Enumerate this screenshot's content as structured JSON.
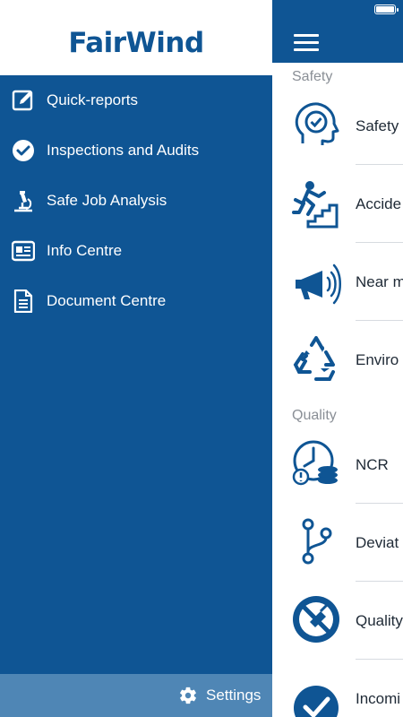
{
  "brand": {
    "logo_text": "FairWind",
    "primary_color": "#0f5594",
    "settings_bar_color": "#4f86b5"
  },
  "drawer": {
    "items": [
      {
        "label": "Quick-reports",
        "icon": "edit-icon"
      },
      {
        "label": "Inspections and Audits",
        "icon": "check-circle-icon"
      },
      {
        "label": "Safe Job Analysis",
        "icon": "microscope-icon"
      },
      {
        "label": "Info Centre",
        "icon": "news-card-icon"
      },
      {
        "label": "Document Centre",
        "icon": "document-icon"
      }
    ],
    "settings_label": "Settings"
  },
  "content": {
    "sections": [
      {
        "label": "Safety",
        "items": [
          {
            "label": "Safety",
            "icon": "head-check-icon"
          },
          {
            "label": "Accide",
            "icon": "falling-stairs-icon"
          },
          {
            "label": "Near m",
            "icon": "megaphone-icon"
          },
          {
            "label": "Enviro",
            "icon": "recycle-icon"
          }
        ]
      },
      {
        "label": "Quality",
        "items": [
          {
            "label": "NCR",
            "icon": "clock-coins-icon"
          },
          {
            "label": "Deviat",
            "icon": "branch-icon"
          },
          {
            "label": "Quality",
            "icon": "no-broom-icon"
          },
          {
            "label": "Incomi",
            "icon": "check-badge-icon"
          }
        ]
      }
    ]
  }
}
